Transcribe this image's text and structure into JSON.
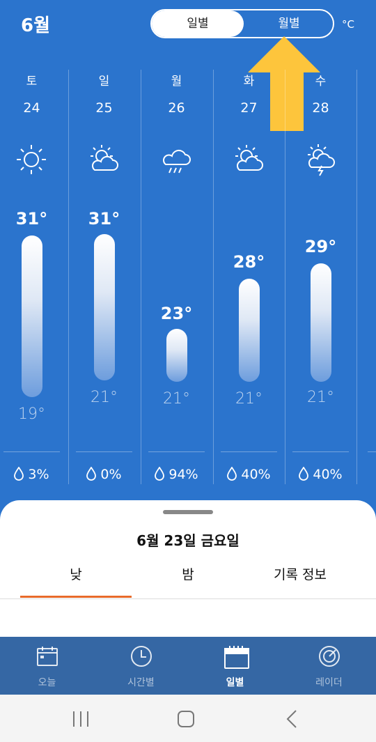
{
  "header": {
    "month": "6월",
    "toggle": {
      "daily": "일별",
      "monthly": "월별"
    },
    "unit": "°C"
  },
  "days": [
    {
      "dow": "토",
      "date": "24",
      "icon": "sun-icon",
      "high": "31°",
      "low": "19°",
      "rain": "3%"
    },
    {
      "dow": "일",
      "date": "25",
      "icon": "sun-cloud-icon",
      "high": "31°",
      "low": "21°",
      "rain": "0%"
    },
    {
      "dow": "월",
      "date": "26",
      "icon": "rain-cloud-icon",
      "high": "23°",
      "low": "21°",
      "rain": "94%"
    },
    {
      "dow": "화",
      "date": "27",
      "icon": "sun-cloud-icon",
      "high": "28°",
      "low": "21°",
      "rain": "40%"
    },
    {
      "dow": "수",
      "date": "28",
      "icon": "thunder-cloud-icon",
      "high": "29°",
      "low": "21°",
      "rain": "40%"
    }
  ],
  "sheet": {
    "title": "6월 23일 금요일",
    "tabs": [
      "낮",
      "밤",
      "기록 정보"
    ]
  },
  "nav": {
    "items": [
      {
        "label": "오늘",
        "icon": "calendar-day-icon"
      },
      {
        "label": "시간별",
        "icon": "clock-icon"
      },
      {
        "label": "일별",
        "icon": "calendar-week-icon"
      },
      {
        "label": "레이더",
        "icon": "radar-icon"
      }
    ]
  },
  "colors": {
    "background": "#2b74cd",
    "nav": "#3567a4",
    "tab_underline": "#e86a2a",
    "arrow": "#fdc53c"
  }
}
